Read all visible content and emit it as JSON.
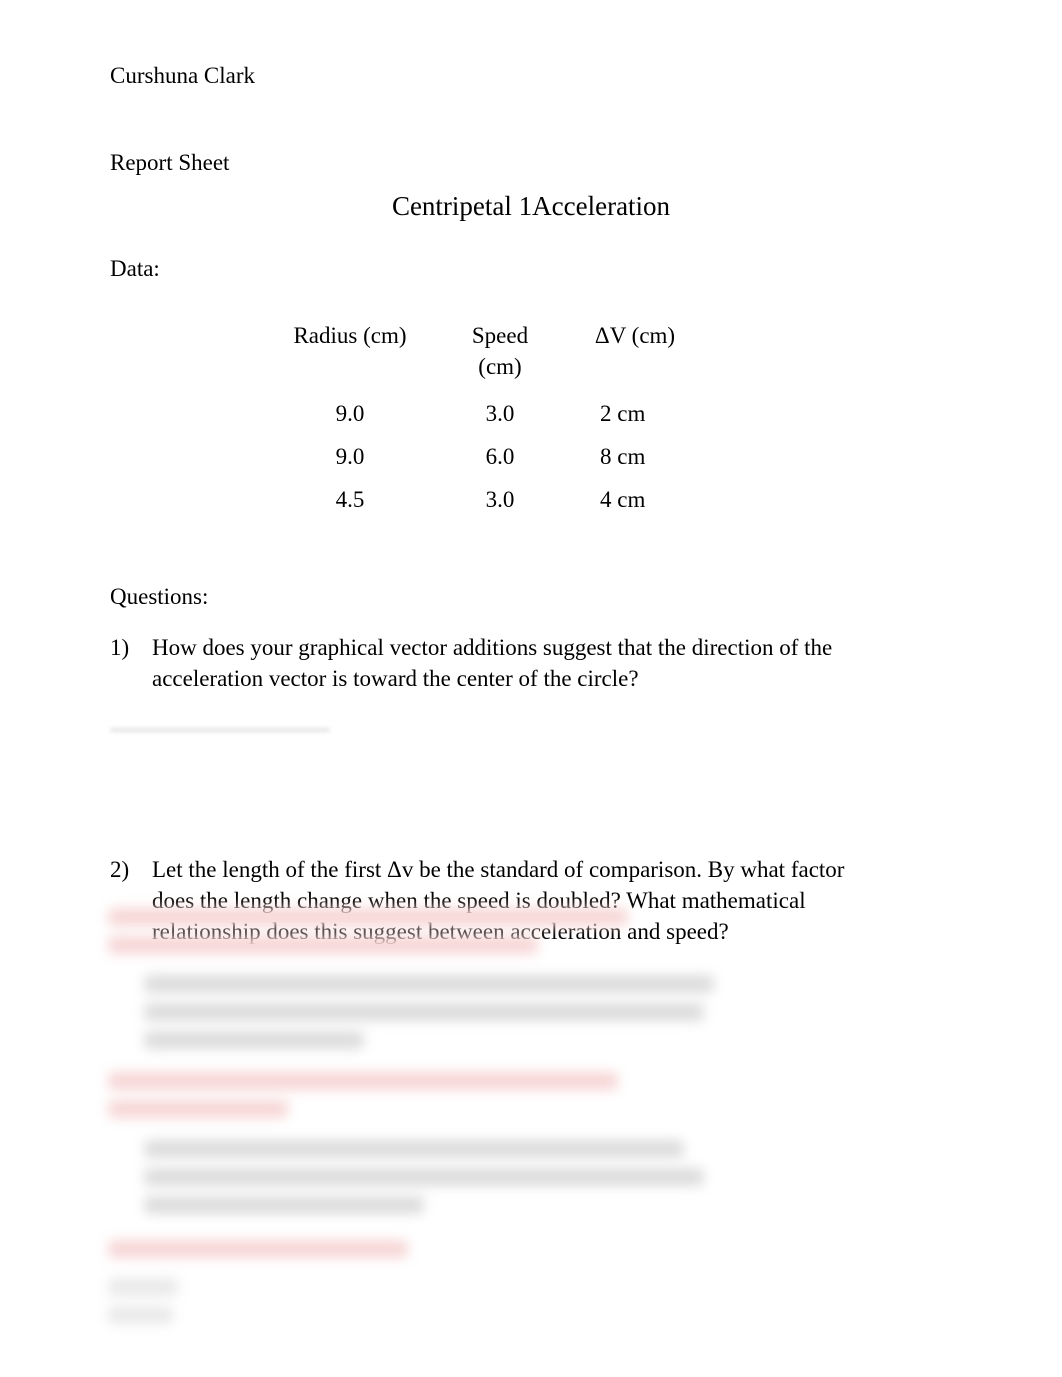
{
  "author": "Curshuna Clark",
  "report_label": "Report Sheet",
  "title": "Centripetal 1Acceleration",
  "data_label": "Data:",
  "table": {
    "headers": {
      "radius": "Radius (cm)",
      "speed": "Speed (cm)",
      "dv": "ΔV (cm)"
    },
    "rows": [
      {
        "radius": "9.0",
        "speed": "3.0",
        "dv": "2 cm"
      },
      {
        "radius": "9.0",
        "speed": "6.0",
        "dv": "8 cm"
      },
      {
        "radius": "4.5",
        "speed": "3.0",
        "dv": "4 cm"
      }
    ]
  },
  "questions_label": "Questions:",
  "questions": {
    "q1": {
      "num": "1)",
      "text": "How does your graphical vector additions suggest that the direction of the acceleration vector is toward the center of the circle?"
    },
    "q2": {
      "num": "2)",
      "text": "Let the length of the first Δv be the standard of comparison. By what factor does the length change when the speed is doubled? What mathematical relationship does this suggest between acceleration and speed?"
    }
  }
}
